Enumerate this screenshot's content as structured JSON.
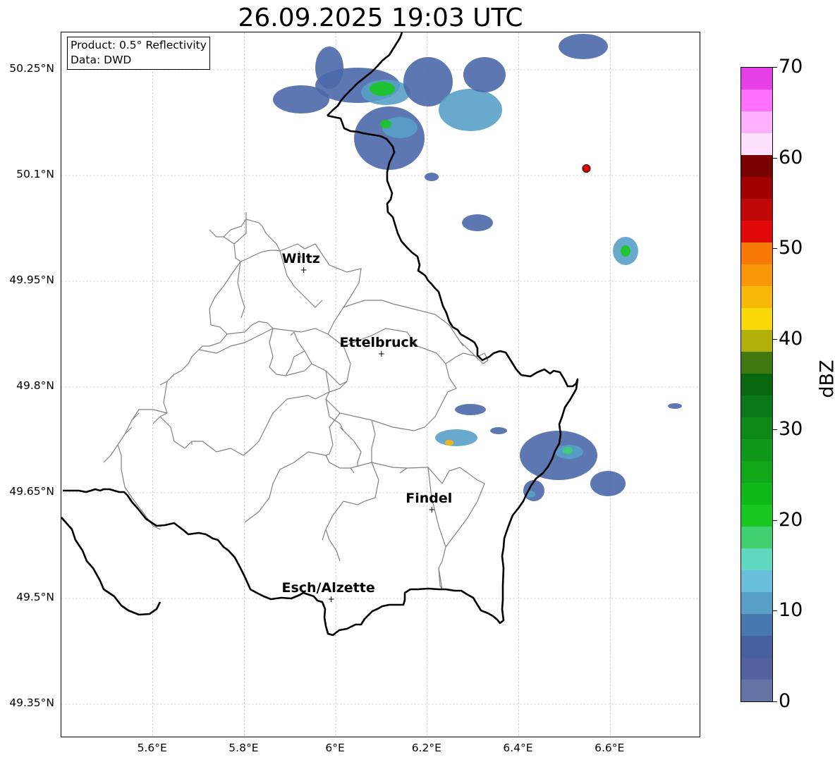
{
  "title": "26.09.2025 19:03 UTC",
  "info_box": {
    "product": "Product: 0.5° Reflectivity",
    "data": "Data: DWD"
  },
  "lat_ticks": [
    "50.25°N",
    "50.1°N",
    "49.95°N",
    "49.8°N",
    "49.65°N",
    "49.5°N",
    "49.35°N"
  ],
  "lon_ticks": [
    "5.6°E",
    "5.8°E",
    "6°E",
    "6.2°E",
    "6.4°E",
    "6.6°E"
  ],
  "cities": [
    {
      "name": "Wiltz",
      "lon": 5.93,
      "lat": 49.966
    },
    {
      "name": "Ettelbruck",
      "lon": 6.1,
      "lat": 49.847
    },
    {
      "name": "Findel",
      "lon": 6.21,
      "lat": 49.626
    },
    {
      "name": "Esch/Alzette",
      "lon": 5.99,
      "lat": 49.499
    }
  ],
  "radar_site": {
    "lon": 6.548,
    "lat": 50.11,
    "color": "#e00000"
  },
  "colorbar": {
    "label": "dBZ",
    "tick_labels": [
      "70",
      "60",
      "50",
      "40",
      "30",
      "20",
      "10",
      "0"
    ],
    "colors": [
      "#6474a4",
      "#5262a0",
      "#4660a0",
      "#4878b0",
      "#58a0c8",
      "#68c0dc",
      "#60d8c0",
      "#40d070",
      "#18c820",
      "#10b818",
      "#10a818",
      "#109818",
      "#108818",
      "#087818",
      "#086810",
      "#407810",
      "#b0b008",
      "#f8d808",
      "#f8b808",
      "#f89808",
      "#f87808",
      "#e00808",
      "#c00808",
      "#a00000",
      "#780000",
      "#ffe0ff",
      "#ffb0ff",
      "#ff70ff",
      "#e840e8"
    ]
  },
  "colors": {
    "border": "#000000",
    "cantons": "#808080",
    "gridlines": "#b0b0b0"
  }
}
